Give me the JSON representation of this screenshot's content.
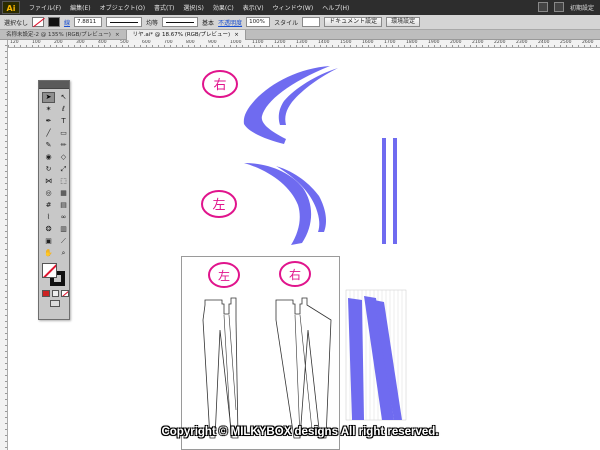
{
  "app": {
    "logo": "Ai",
    "menu": [
      "ファイル(F)",
      "編集(E)",
      "オブジェクト(O)",
      "書式(T)",
      "選択(S)",
      "効果(C)",
      "表示(V)",
      "ウィンドウ(W)",
      "ヘルプ(H)"
    ],
    "workspace": "初期設定"
  },
  "control_bar": {
    "selection": "選択なし",
    "stroke_label": "線",
    "stroke_weight": "7.8811",
    "profile_label": "均等",
    "brush_label": "基本",
    "opacity_label": "不透明度",
    "opacity_value": "100%",
    "style_label": "スタイル",
    "doc_setup_button": "ドキュメント設定",
    "prefs_button": "環境設定"
  },
  "tabs": [
    {
      "label": "名称未設定-2 @ 135% (RGB/プレビュー)",
      "active": false
    },
    {
      "label": "リヤ.ai* @ 18.67% (RGB/プレビュー)",
      "active": true
    }
  ],
  "ruler": {
    "ticks": [
      "120",
      "100",
      "200",
      "300",
      "400",
      "500",
      "600",
      "700",
      "800",
      "900",
      "1000",
      "1100",
      "1200",
      "1300",
      "1400",
      "1500",
      "1600",
      "1700",
      "1800",
      "1900",
      "2000",
      "2100",
      "2200",
      "2300",
      "2400",
      "2500",
      "2600"
    ]
  },
  "annotations": {
    "right_top": "右",
    "left_mid": "左",
    "left_board": "左",
    "right_board": "右"
  },
  "colors": {
    "shape_fill": "#6f6bf0",
    "annotation_pink": "#e0148c",
    "outline": "#333333"
  },
  "icons": {
    "tools": [
      "selection-tool-icon",
      "direct-selection-tool-icon",
      "magic-wand-tool-icon",
      "lasso-tool-icon",
      "pen-tool-icon",
      "type-tool-icon",
      "line-tool-icon",
      "rectangle-tool-icon",
      "paintbrush-tool-icon",
      "pencil-tool-icon",
      "blob-brush-tool-icon",
      "eraser-tool-icon",
      "rotate-tool-icon",
      "scale-tool-icon",
      "width-tool-icon",
      "free-transform-tool-icon",
      "shape-builder-tool-icon",
      "perspective-grid-tool-icon",
      "mesh-tool-icon",
      "gradient-tool-icon",
      "eyedropper-tool-icon",
      "blend-tool-icon",
      "symbol-sprayer-tool-icon",
      "column-graph-tool-icon",
      "artboard-tool-icon",
      "slice-tool-icon",
      "hand-tool-icon",
      "zoom-tool-icon"
    ]
  },
  "copyright": "Copyright © MILKYBOX designs All right reserved."
}
